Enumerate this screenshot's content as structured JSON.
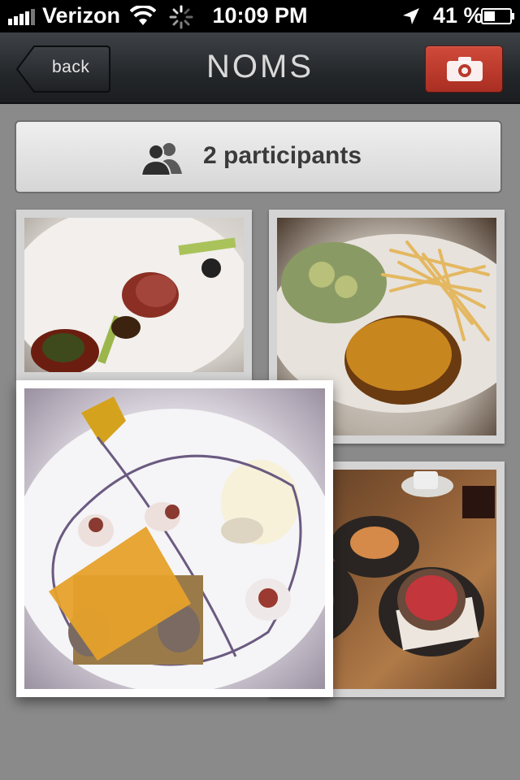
{
  "status_bar": {
    "carrier": "Verizon",
    "time": "10:09 PM",
    "battery_percent": "41 %",
    "icons": [
      "signal-icon",
      "wifi-icon",
      "activity-spinner-icon",
      "location-arrow-icon",
      "battery-icon"
    ]
  },
  "nav": {
    "back_label": "back",
    "title": "NOMS",
    "camera_icon": "camera-icon"
  },
  "participants": {
    "label": "2 participants",
    "icon": "people-icon"
  },
  "colors": {
    "camera_button": "#c23d2f",
    "nav_bar": "#24272a",
    "page_background": "#8a8a8a"
  },
  "photos": [
    {
      "subject": "food photo"
    },
    {
      "subject": "food photo"
    },
    {
      "subject": "food photo"
    },
    {
      "subject": "food photo"
    }
  ]
}
